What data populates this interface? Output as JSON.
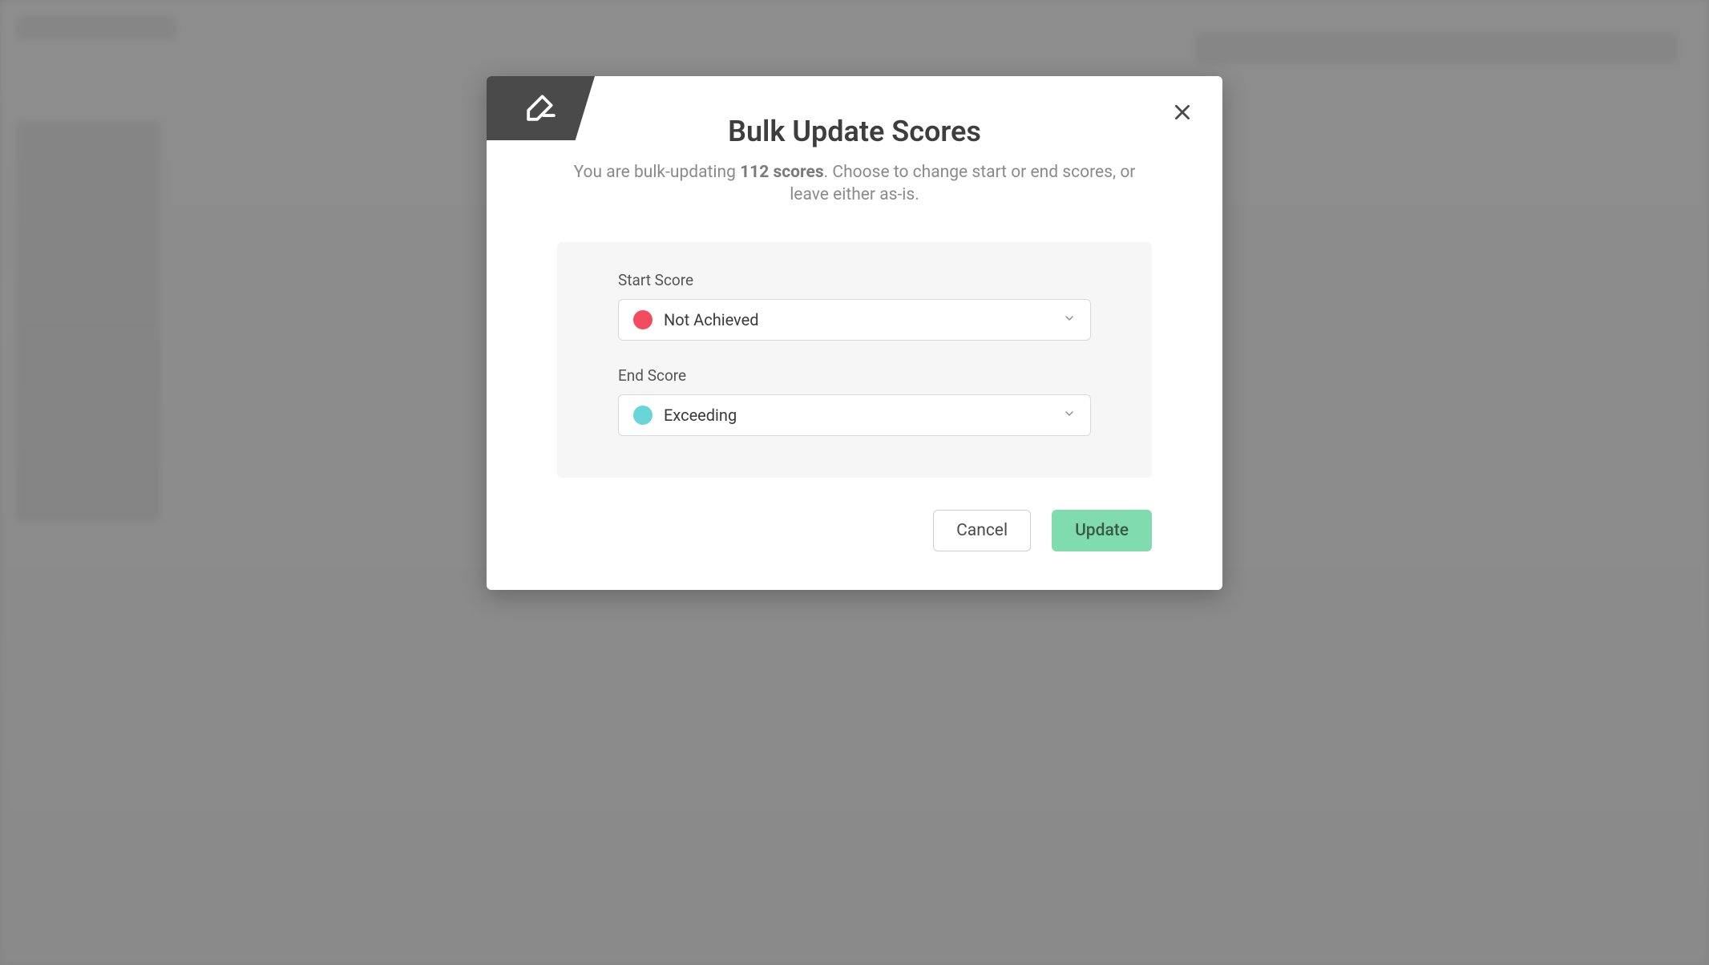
{
  "modal": {
    "title": "Bulk Update Scores",
    "subtitle_prefix": "You are bulk-updating ",
    "score_count": "112 scores",
    "subtitle_suffix": ". Choose to change start or end scores, or leave either as-is.",
    "start_score": {
      "label": "Start Score",
      "value": "Not Achieved",
      "color": "#f54b5e"
    },
    "end_score": {
      "label": "End Score",
      "value": "Exceeding",
      "color": "#68d6d6"
    },
    "buttons": {
      "cancel": "Cancel",
      "update": "Update"
    }
  }
}
